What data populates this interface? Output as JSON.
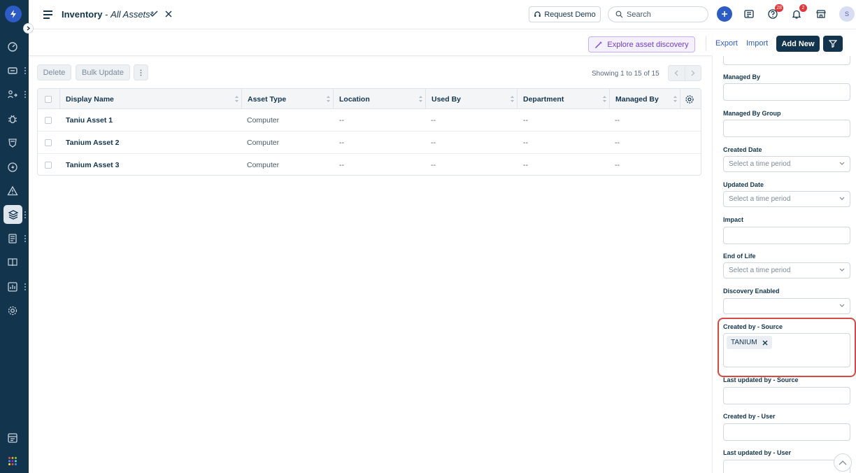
{
  "header": {
    "title": "Inventory",
    "separator": " - ",
    "view": "All Assets*",
    "request_demo": "Request Demo",
    "search_placeholder": "Search",
    "help_badge": "28",
    "notif_badge": "2",
    "avatar_initial": "S"
  },
  "toolbar": {
    "explore": "Explore asset discovery",
    "export": "Export",
    "import": "Import",
    "add_new": "Add New"
  },
  "list": {
    "delete": "Delete",
    "bulk_update": "Bulk Update",
    "showing": "Showing 1 to 15 of 15"
  },
  "table": {
    "columns": [
      "Display Name",
      "Asset Type",
      "Location",
      "Used By",
      "Department",
      "Managed By"
    ],
    "rows": [
      [
        "Taniu Asset 1",
        "Computer",
        "--",
        "--",
        "--",
        "--"
      ],
      [
        "Tanium Asset 2",
        "Computer",
        "--",
        "--",
        "--",
        "--"
      ],
      [
        "Tanium Asset 3",
        "Computer",
        "--",
        "--",
        "--",
        "--"
      ]
    ]
  },
  "filters": {
    "managed_by": "Managed By",
    "managed_by_group": "Managed By Group",
    "created_date": "Created Date",
    "updated_date": "Updated Date",
    "impact": "Impact",
    "end_of_life": "End of Life",
    "discovery_enabled": "Discovery Enabled",
    "created_by_source": "Created by - Source",
    "created_by_source_tag": "TANIUM",
    "last_updated_by_source": "Last updated by - Source",
    "created_by_user": "Created by - User",
    "last_updated_by_user": "Last updated by - User",
    "time_placeholder": "Select a time period"
  },
  "colors": {
    "rail": "#12344d",
    "primary": "#2c5cc5",
    "highlight": "#d64a43",
    "explore": "#6f3ed6"
  }
}
